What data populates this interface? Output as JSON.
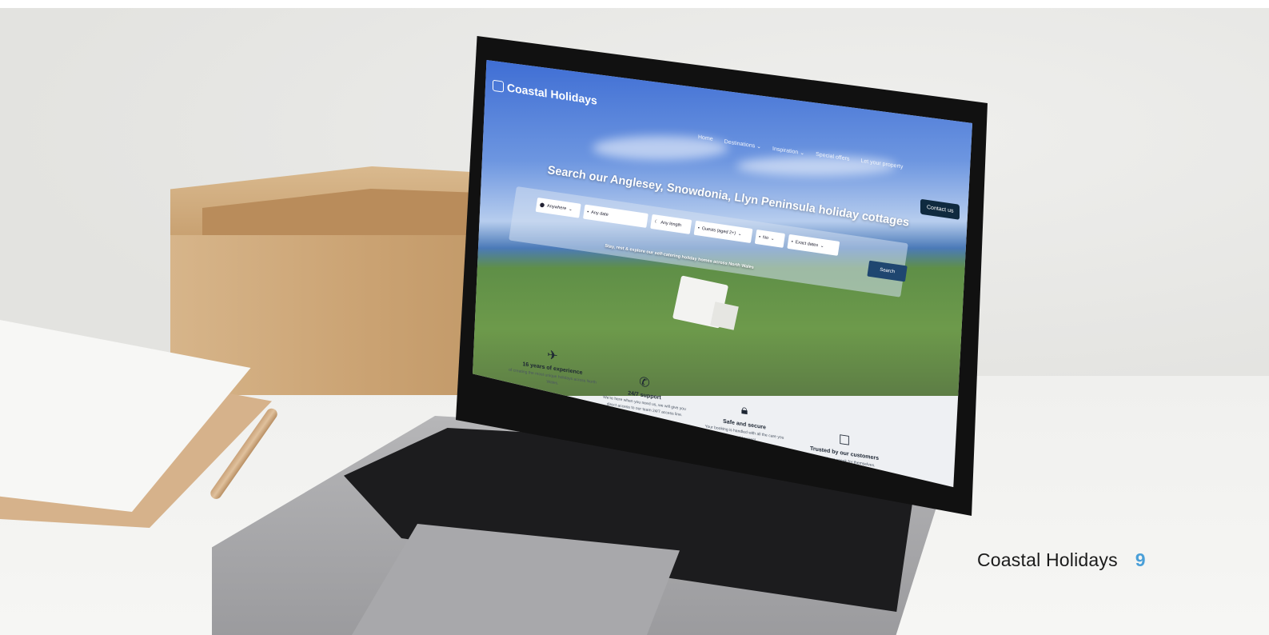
{
  "site": {
    "logo": "Coastal Holidays",
    "nav": [
      "Home",
      "Destinations ⌄",
      "Inspiration ⌄",
      "Special offers",
      "Let your property"
    ],
    "contact_button": "Contact us"
  },
  "hero": {
    "title": "Search our Anglesey, Snowdonia, Llyn Peninsula holiday cottages",
    "subtitle": "Stay, rest & explore our self-catering holiday homes across North Wales",
    "search_fields": {
      "location": "Anywhere",
      "date": "Any date",
      "length": "Any length",
      "guests": "Guests (aged 2+)",
      "pets": "No",
      "flexibility": "Exact dates"
    },
    "search_button": "Search"
  },
  "features": [
    {
      "icon": "plane-icon",
      "title": "16 years of experience",
      "desc": "of creating the most unique holidays across North Wales."
    },
    {
      "icon": "phone-icon",
      "title": "24/7 support",
      "desc": "We're here when you need us, we will give you direct access to our team 24/7 access line."
    },
    {
      "icon": "lock-icon",
      "title": "Safe and secure",
      "desc": "Your booking is handled with all the care you would expect."
    },
    {
      "icon": "handshake-icon",
      "title": "Trusted by our customers",
      "desc": "Our reviews speak for themselves."
    }
  ],
  "caption": {
    "brand": "Coastal Holidays",
    "page_number": "9"
  }
}
